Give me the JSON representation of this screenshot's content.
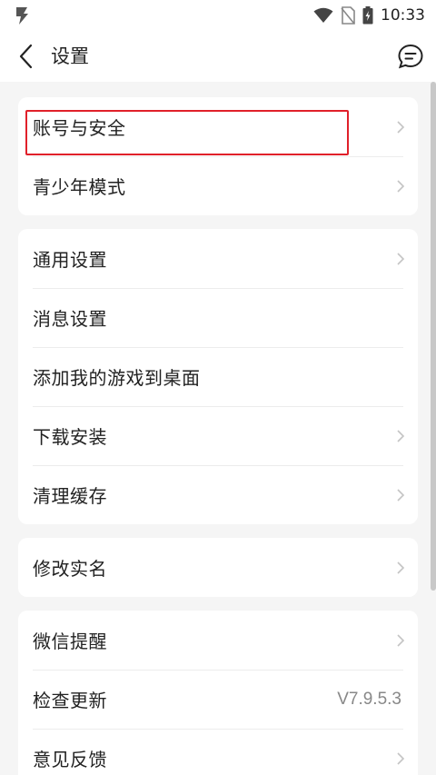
{
  "status_bar": {
    "time": "10:33"
  },
  "header": {
    "title": "设置"
  },
  "groups": [
    {
      "items": [
        {
          "label": "账号与安全",
          "chevron": true
        },
        {
          "label": "青少年模式",
          "chevron": true
        }
      ]
    },
    {
      "items": [
        {
          "label": "通用设置",
          "chevron": true
        },
        {
          "label": "消息设置",
          "chevron": false
        },
        {
          "label": "添加我的游戏到桌面",
          "chevron": false
        },
        {
          "label": "下载安装",
          "chevron": true
        },
        {
          "label": "清理缓存",
          "chevron": true
        }
      ]
    },
    {
      "items": [
        {
          "label": "修改实名",
          "chevron": true
        }
      ]
    },
    {
      "items": [
        {
          "label": "微信提醒",
          "chevron": true
        },
        {
          "label": "检查更新",
          "value": "V7.9.5.3"
        },
        {
          "label": "意见反馈",
          "chevron": true
        }
      ]
    }
  ],
  "colors": {
    "highlight": "#e0202a",
    "text": "#222222",
    "secondary": "#888888",
    "background": "#f5f5f5"
  }
}
